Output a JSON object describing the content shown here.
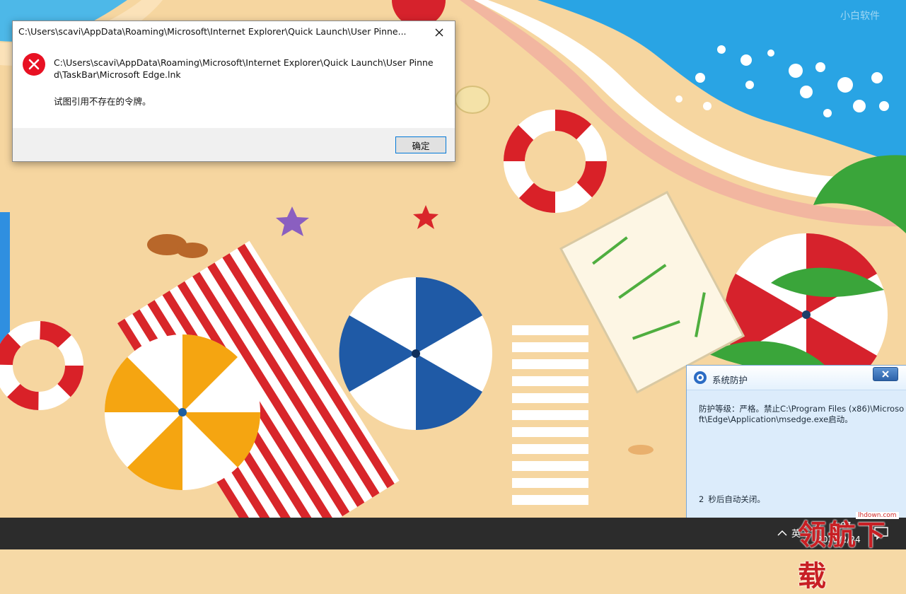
{
  "error_dialog": {
    "title": "C:\\Users\\scavi\\AppData\\Roaming\\Microsoft\\Internet Explorer\\Quick Launch\\User Pinne...",
    "message": "C:\\Users\\scavi\\AppData\\Roaming\\Microsoft\\Internet Explorer\\Quick Launch\\User Pinned\\TaskBar\\Microsoft Edge.lnk",
    "detail": "试图引用不存在的令牌。",
    "ok_label": "确定",
    "icon": "error-icon"
  },
  "protection_popup": {
    "title": "系统防护",
    "message": "防护等级：严格。禁止C:\\Program Files (x86)\\Microsoft\\Edge\\Application\\msedge.exe启动。",
    "countdown_number": "2",
    "countdown_text": "秒后自动关闭。"
  },
  "taskbar": {
    "language": "英",
    "time": "1:07",
    "date": "2022/2/24"
  },
  "watermarks": {
    "top_right": "小白软件",
    "site": "lhdown.com",
    "brand": "领航下载"
  },
  "colors": {
    "error_red": "#e81123",
    "button_border": "#0078d7",
    "popup_bg": "#dcecfb",
    "taskbar": "#2c2c2c"
  }
}
